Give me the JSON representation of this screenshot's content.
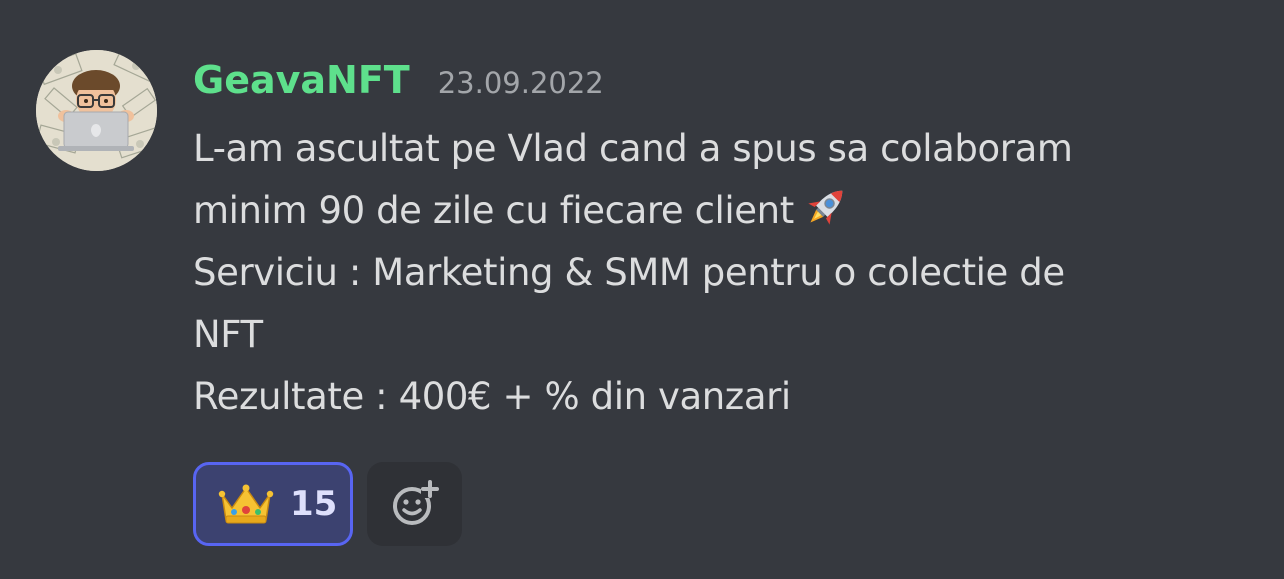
{
  "message": {
    "username": "GeavaNFT",
    "timestamp": "23.09.2022",
    "lines": [
      "L-am ascultat pe Vlad cand a spus sa colaboram",
      "minim 90 de zile cu fiecare client",
      "Serviciu : Marketing & SMM pentru o colectie de",
      "NFT",
      "Rezultate : 400€ + % din vanzari"
    ],
    "inline_emoji": "rocket-icon"
  },
  "reactions": [
    {
      "emoji": "crown-icon",
      "count": "15",
      "selected": true
    }
  ],
  "add_reaction": {
    "icon": "add-reaction-icon"
  },
  "colors": {
    "background": "#36393f",
    "username": "#5ee08c",
    "text": "#dcddde",
    "timestamp": "#a3a6aa",
    "reaction_selected_bg": "#3c4270",
    "reaction_selected_border": "#5865f2"
  }
}
